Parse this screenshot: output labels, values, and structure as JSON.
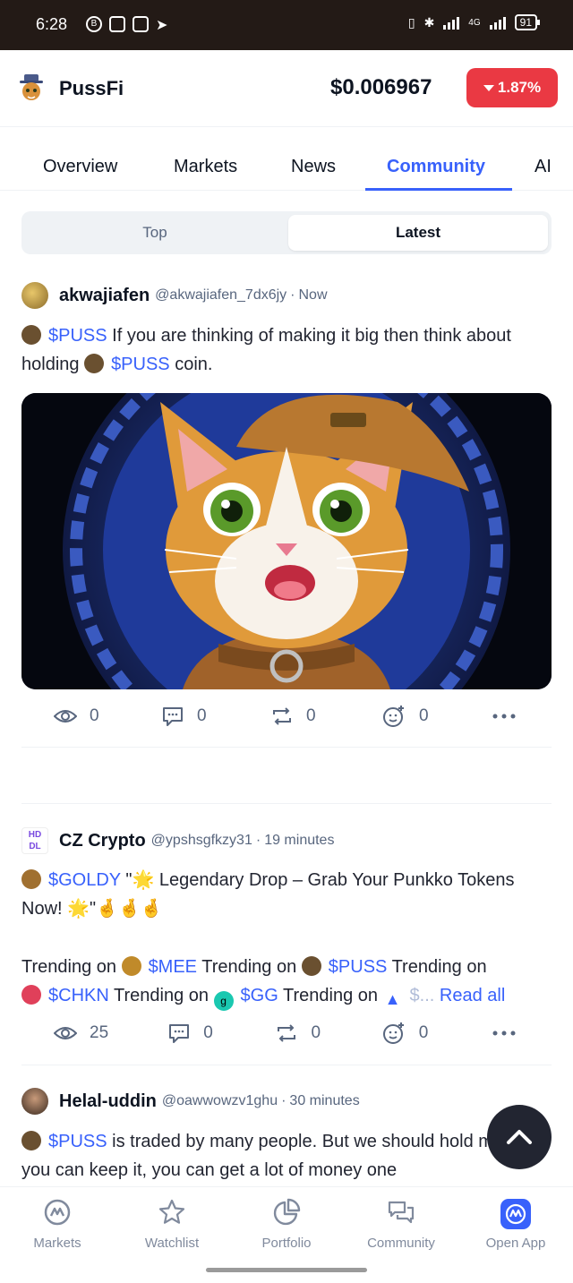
{
  "status_bar": {
    "time": "6:28",
    "battery": "91",
    "network": "4G"
  },
  "header": {
    "app_name": "PussFi",
    "price": "$0.006967",
    "change": "1.87%",
    "change_color": "#ea3943"
  },
  "tabs": [
    {
      "label": "Overview"
    },
    {
      "label": "Markets"
    },
    {
      "label": "News"
    },
    {
      "label": "Community",
      "active": true
    },
    {
      "label": "AI"
    }
  ],
  "segment": {
    "top_label": "Top",
    "latest_label": "Latest",
    "selected": "Latest"
  },
  "posts": [
    {
      "author": "akwajiafen",
      "handle": "@akwajiafen_7dx6jy",
      "time": "Now",
      "text": {
        "t1": "$PUSS",
        "t2": " If you are thinking of making it big then think about holding ",
        "t3": "$PUSS",
        "t4": " coin."
      },
      "stats": {
        "views": "0",
        "comments": "0",
        "reposts": "0",
        "reactions": "0"
      }
    },
    {
      "author": "CZ Crypto",
      "handle": "@ypshsgfkzy31",
      "time": "19 minutes",
      "text": {
        "t1": "$GOLDY",
        "t2": " \"🌟 Legendary Drop – Grab Your Punkko Tokens Now! 🌟\"🤞🤞🤞",
        "t3": "Trending on ",
        "t4": "$MEE",
        "t5": " Trending on ",
        "t6": "$PUSS",
        "t7": " Trending on ",
        "t8": "$CHKN",
        "t9": " Trending on ",
        "t10": "$GG",
        "t11": " Trending on ",
        "t12": "$...",
        "read_all": "Read all"
      },
      "stats": {
        "views": "25",
        "comments": "0",
        "reposts": "0",
        "reactions": "0"
      }
    },
    {
      "author": "Helal-uddin",
      "handle": "@oawwowzv1ghu",
      "time": "30 minutes",
      "text": {
        "t1": "$PUSS",
        "t2": " is traded by many people. But we should hold more. If you can keep it, you can get a lot of money one"
      }
    }
  ],
  "bottom_nav": [
    {
      "label": "Markets",
      "icon": "coinmarketcap-icon"
    },
    {
      "label": "Watchlist",
      "icon": "star-icon"
    },
    {
      "label": "Portfolio",
      "icon": "pie-chart-icon"
    },
    {
      "label": "Community",
      "icon": "chat-bubbles-icon"
    },
    {
      "label": "Open App",
      "icon": "app-logo-icon"
    }
  ],
  "colors": {
    "accent": "#3861fb",
    "negative": "#ea3943",
    "text_secondary": "#58667e"
  }
}
